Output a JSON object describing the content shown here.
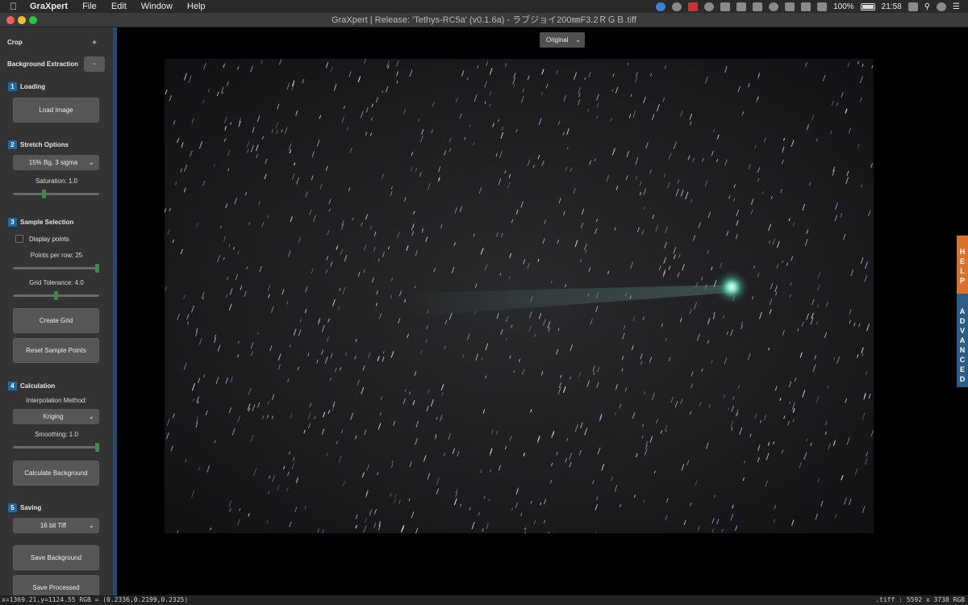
{
  "menubar": {
    "app": "GraXpert",
    "items": [
      "File",
      "Edit",
      "Window",
      "Help"
    ],
    "battery": "100%",
    "clock": "21:58"
  },
  "window": {
    "title": "GraXpert | Release: 'Tethys-RC5a' (v0.1.6a) - ラブジョイ200㎜F3.2ＲＧＢ.tiff"
  },
  "sidebar": {
    "crop_label": "Crop",
    "crop_toggle": "+",
    "bg_extraction_label": "Background Extraction",
    "bg_extraction_toggle": "-",
    "sections": {
      "loading": {
        "num": "1",
        "title": "Loading",
        "load_button": "Load Image"
      },
      "stretch": {
        "num": "2",
        "title": "Stretch Options",
        "stretch_value": "15% Bg, 3 sigma",
        "saturation_label": "Saturation: 1.0",
        "saturation_level": 0.35
      },
      "sample": {
        "num": "3",
        "title": "Sample Selection",
        "display_points": "Display points",
        "points_label": "Points per row: 25",
        "points_level": 1.0,
        "tolerance_label": "Grid Tolerance: 4.0",
        "tolerance_level": 0.5,
        "create_grid": "Create Grid",
        "reset_points": "Reset Sample Points"
      },
      "calculation": {
        "num": "4",
        "title": "Calculation",
        "interp_label": "Interpolation Method:",
        "interp_value": "Kriging",
        "smoothing_label": "Smoothing: 1.0",
        "smoothing_level": 1.0,
        "calc_button": "Calculate Background"
      },
      "saving": {
        "num": "5",
        "title": "Saving",
        "format_value": "16 bit Tiff",
        "save_bg": "Save Background",
        "save_processed": "Save Processed"
      }
    }
  },
  "viewer": {
    "view_mode": "Original"
  },
  "side_tabs": {
    "help": "HELP",
    "advanced": "ADVANCED"
  },
  "status": {
    "left": "x=1369.21,y=1124.55  RGB = (0.2336,0.2199,0.2325)",
    "right": ".tiff : 5592 x 3738 RGB"
  }
}
